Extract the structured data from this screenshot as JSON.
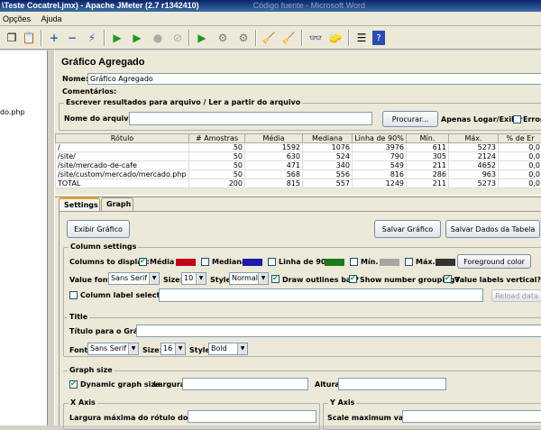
{
  "window": {
    "title": "\\Teste Cocatrel.jmx) - Apache JMeter (2.7 r1342410)",
    "ghost_title": "Código fuente - Microsoft Word"
  },
  "menu": {
    "options": "Opções",
    "help": "Ajuda"
  },
  "tree": {
    "item": "do.php"
  },
  "panel": {
    "title": "Gráfico Agregado",
    "name_label": "Nome:",
    "name_value": "Gráfico Agregado",
    "comments_label": "Comentários:",
    "file_section": "Escrever resultados para arquivo / Ler a partir do arquivo",
    "filename_label": "Nome do arquivo",
    "filename_value": "",
    "browse_button": "Procurar...",
    "log_errors_label": "Apenas Logar/Exibir",
    "errors_label": "Erros"
  },
  "table": {
    "headers": [
      "Rótulo",
      "# Amostras",
      "Média",
      "Mediana",
      "Linha de 90%",
      "Mín.",
      "Máx.",
      "% de Er"
    ],
    "rows": [
      [
        "/",
        "50",
        "1592",
        "1076",
        "3976",
        "611",
        "5273",
        "0,0"
      ],
      [
        "/site/",
        "50",
        "630",
        "524",
        "790",
        "305",
        "2124",
        "0,0"
      ],
      [
        "/site/mercado-de-cafe",
        "50",
        "471",
        "340",
        "549",
        "211",
        "4652",
        "0,0"
      ],
      [
        "/site/custom/mercado/mercado.php",
        "50",
        "568",
        "556",
        "816",
        "286",
        "963",
        "0,0"
      ],
      [
        "TOTAL",
        "200",
        "815",
        "557",
        "1249",
        "211",
        "5273",
        "0,0"
      ]
    ]
  },
  "tabs": {
    "settings": "Settings",
    "graph": "Graph"
  },
  "buttons": {
    "show_graph": "Exibir Gráfico",
    "save_graph": "Salvar Gráfico",
    "save_table": "Salvar Dados da Tabela"
  },
  "columns": {
    "section": "Column settings",
    "display_label": "Columns to display:",
    "avg": "Média",
    "median": "Mediana",
    "line90": "Linha de 90%",
    "min": "Mín.",
    "max": "Máx.",
    "avg_color": "#c0001a",
    "median_color": "#1c1ca8",
    "line90_color": "#1c7a1c",
    "min_color": "#a6a6a6",
    "max_color": "#333333",
    "fg_button": "Foreground color",
    "value_font_label": "Value font:",
    "value_font": "Sans Serif",
    "size_label": "Size:",
    "size_value": "10",
    "style_label": "Style:",
    "style_value": "Normal",
    "outlines": "Draw outlines bar?",
    "grouping": "Show number grouping?",
    "vertical": "Value labels vertical?",
    "label_selection": "Column label selection:",
    "reload": "Reload data"
  },
  "title": {
    "section": "Title",
    "graph_title_label": "Título para o Gráfico",
    "font_label": "Font:",
    "font": "Sans Serif",
    "size_label": "Size:",
    "size": "16",
    "style_label": "Style:",
    "style": "Bold"
  },
  "size": {
    "section": "Graph size",
    "dynamic": "Dynamic graph size",
    "width_label": "Largura",
    "height_label": "Altura"
  },
  "xaxis": {
    "section": "X Axis",
    "max_label": "Largura máxima do rótulo do eixo x"
  },
  "yaxis": {
    "section": "Y Axis",
    "max_label": "Scale maximum value:"
  }
}
